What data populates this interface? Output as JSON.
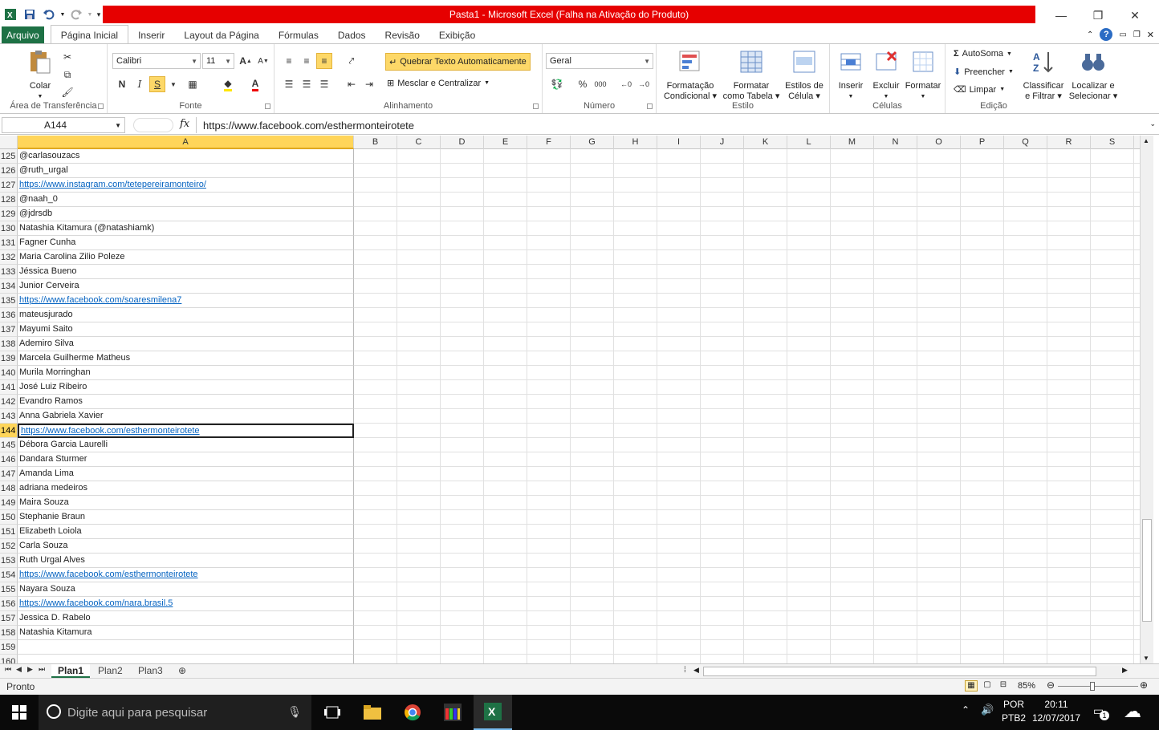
{
  "window": {
    "title": "Pasta1  -  Microsoft Excel (Falha na Ativação do Produto)",
    "title_bar_color": "#e60000"
  },
  "ribbon_tabs": {
    "file": "Arquivo",
    "items": [
      "Página Inicial",
      "Inserir",
      "Layout da Página",
      "Fórmulas",
      "Dados",
      "Revisão",
      "Exibição"
    ],
    "active": "Página Inicial",
    "file_color": "#1e7145"
  },
  "clipboard": {
    "paste": "Colar",
    "group": "Área de Transferência"
  },
  "font": {
    "name": "Calibri",
    "size": "11",
    "bold": "N",
    "italic": "I",
    "underline": "S",
    "group": "Fonte"
  },
  "alignment": {
    "wrap": "Quebrar Texto Automaticamente",
    "merge": "Mesclar e Centralizar",
    "group": "Alinhamento"
  },
  "number": {
    "format": "Geral",
    "percent": "%",
    "thousands": "000",
    "group": "Número"
  },
  "styles": {
    "conditional": [
      "Formatação",
      "Condicional"
    ],
    "as_table": [
      "Formatar",
      "como Tabela"
    ],
    "cell_styles": [
      "Estilos de",
      "Célula"
    ],
    "group": "Estilo"
  },
  "cells": {
    "insert": "Inserir",
    "delete": "Excluir",
    "format": "Formatar",
    "group": "Células"
  },
  "editing": {
    "autosum": "AutoSoma",
    "fill": "Preencher",
    "clear": "Limpar",
    "sort": [
      "Classificar",
      "e Filtrar"
    ],
    "find": [
      "Localizar e",
      "Selecionar"
    ],
    "group": "Edição"
  },
  "formula_bar": {
    "name_box": "A144",
    "fx": "fx",
    "value": "https://www.facebook.com/esthermonteirotete"
  },
  "columns": [
    "A",
    "B",
    "C",
    "D",
    "E",
    "F",
    "G",
    "H",
    "I",
    "J",
    "K",
    "L",
    "M",
    "N",
    "O",
    "P",
    "Q",
    "R",
    "S"
  ],
  "rows": [
    {
      "n": "125",
      "a": "@carlasouzacs",
      "link": false
    },
    {
      "n": "126",
      "a": "@ruth_urgal",
      "link": false
    },
    {
      "n": "127",
      "a": "https://www.instagram.com/tetepereiramonteiro/",
      "link": true
    },
    {
      "n": "128",
      "a": "@naah_0",
      "link": false
    },
    {
      "n": "129",
      "a": "@jdrsdb",
      "link": false
    },
    {
      "n": "130",
      "a": "Natashia Kitamura (@natashiamk)",
      "link": false
    },
    {
      "n": "131",
      "a": "Fagner Cunha",
      "link": false
    },
    {
      "n": "132",
      "a": "Maria Carolina Zilio Poleze",
      "link": false
    },
    {
      "n": "133",
      "a": "Jéssica Bueno",
      "link": false
    },
    {
      "n": "134",
      "a": "Junior Cerveira",
      "link": false
    },
    {
      "n": "135",
      "a": "https://www.facebook.com/soaresmilena7",
      "link": true
    },
    {
      "n": "136",
      "a": "mateusjurado",
      "link": false
    },
    {
      "n": "137",
      "a": "Mayumi Saito",
      "link": false
    },
    {
      "n": "138",
      "a": "Ademiro Silva",
      "link": false
    },
    {
      "n": "139",
      "a": "Marcela Guilherme Matheus",
      "link": false
    },
    {
      "n": "140",
      "a": "Murila Morringhan",
      "link": false
    },
    {
      "n": "141",
      "a": "José Luiz Ribeiro",
      "link": false
    },
    {
      "n": "142",
      "a": "Evandro Ramos",
      "link": false
    },
    {
      "n": "143",
      "a": "Anna Gabriela Xavier",
      "link": false
    },
    {
      "n": "144",
      "a": "https://www.facebook.com/esthermonteirotete",
      "link": true,
      "active": true
    },
    {
      "n": "145",
      "a": "Débora Garcia Laurelli",
      "link": false
    },
    {
      "n": "146",
      "a": "Dandara Sturmer",
      "link": false
    },
    {
      "n": "147",
      "a": "Amanda Lima",
      "link": false
    },
    {
      "n": "148",
      "a": "adriana medeiros",
      "link": false
    },
    {
      "n": "149",
      "a": "Maira Souza",
      "link": false
    },
    {
      "n": "150",
      "a": "Stephanie Braun",
      "link": false
    },
    {
      "n": "151",
      "a": "Elizabeth Loiola",
      "link": false
    },
    {
      "n": "152",
      "a": "Carla Souza",
      "link": false
    },
    {
      "n": "153",
      "a": "Ruth Urgal Alves",
      "link": false
    },
    {
      "n": "154",
      "a": "https://www.facebook.com/esthermonteirotete",
      "link": true
    },
    {
      "n": "155",
      "a": "Nayara Souza",
      "link": false
    },
    {
      "n": "156",
      "a": "https://www.facebook.com/nara.brasil.5",
      "link": true
    },
    {
      "n": "157",
      "a": "Jessica D. Rabelo",
      "link": false
    },
    {
      "n": "158",
      "a": "Natashia Kitamura",
      "link": false
    },
    {
      "n": "159",
      "a": "",
      "link": false
    },
    {
      "n": "160",
      "a": "",
      "link": false
    }
  ],
  "sheets": [
    "Plan1",
    "Plan2",
    "Plan3"
  ],
  "active_sheet": "Plan1",
  "status": {
    "text": "Pronto",
    "zoom": "85%"
  },
  "taskbar": {
    "search_placeholder": "Digite aqui para pesquisar",
    "lang1": "POR",
    "lang2": "PTB2",
    "time": "20:11",
    "date": "12/07/2017",
    "notifications": "1"
  }
}
